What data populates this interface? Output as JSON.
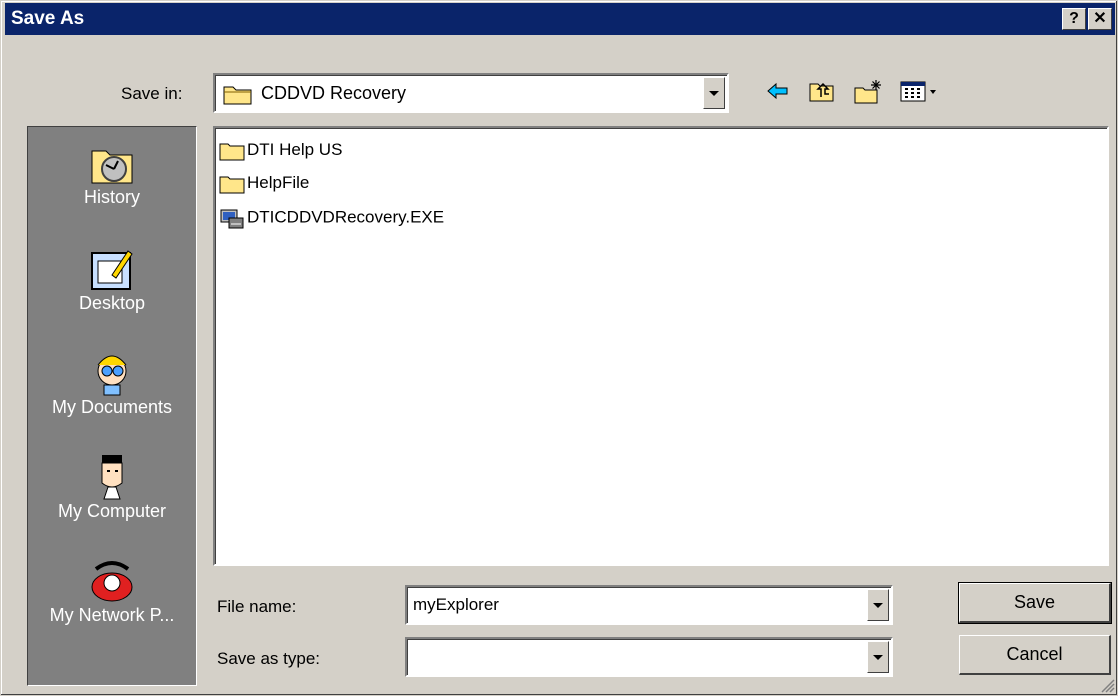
{
  "window": {
    "title": "Save As",
    "help_button": "?",
    "close_button": "✕"
  },
  "toolbar": {
    "save_in_label": "Save in:",
    "current_folder": "CDDVD Recovery",
    "icons": [
      "back-icon",
      "up-folder-icon",
      "new-folder-icon",
      "view-menu-icon"
    ]
  },
  "places": [
    {
      "label": "History",
      "icon": "history-icon"
    },
    {
      "label": "Desktop",
      "icon": "desktop-icon"
    },
    {
      "label": "My Documents",
      "icon": "my-documents-icon"
    },
    {
      "label": "My Computer",
      "icon": "my-computer-icon"
    },
    {
      "label": "My Network P...",
      "icon": "my-network-places-icon"
    }
  ],
  "files": [
    {
      "name": "DTI Help US",
      "type": "folder"
    },
    {
      "name": "HelpFile",
      "type": "folder"
    },
    {
      "name": "DTICDDVDRecovery.EXE",
      "type": "exe"
    }
  ],
  "form": {
    "file_name_label": "File name:",
    "file_name_value": "myExplorer",
    "save_as_type_label": "Save as type:",
    "save_as_type_value": ""
  },
  "buttons": {
    "save": "Save",
    "cancel": "Cancel"
  },
  "colors": {
    "titlebar": "#0a246a",
    "face": "#d4d0c8",
    "places_bar": "#808080",
    "folder": "#ffe68a"
  }
}
